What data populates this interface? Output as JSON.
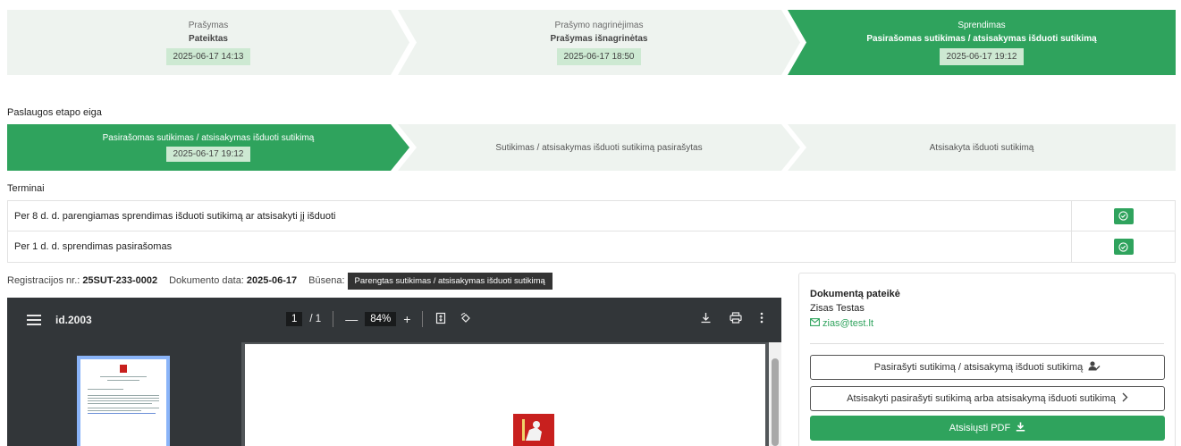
{
  "stepper": {
    "steps": [
      {
        "title": "Prašymas",
        "subtitle": "Pateiktas",
        "date": "2025-06-17 14:13"
      },
      {
        "title": "Prašymo nagrinėjimas",
        "subtitle": "Prašymas išnagrinėtas",
        "date": "2025-06-17 18:50"
      },
      {
        "title": "Sprendimas",
        "subtitle": "Pasirašomas sutikimas / atsisakymas išduoti sutikimą",
        "date": "2025-06-17 19:12"
      }
    ],
    "active_color": "#2fa35d"
  },
  "stage_flow": {
    "heading": "Paslaugos etapo eiga",
    "steps": [
      {
        "label": "Pasirašomas sutikimas / atsisakymas išduoti sutikimą",
        "date": "2025-06-17 19:12"
      },
      {
        "label": "Sutikimas / atsisakymas išduoti sutikimą pasirašytas"
      },
      {
        "label": "Atsisakyta išduoti sutikimą"
      }
    ]
  },
  "terms": {
    "heading": "Terminai",
    "rows": [
      {
        "text": "Per 8 d. d. parengiamas sprendimas išduoti sutikimą ar atsisakyti jį išduoti",
        "status_icon": "check-circle-icon"
      },
      {
        "text": "Per 1 d. d. sprendimas pasirašomas",
        "status_icon": "check-circle-icon"
      }
    ]
  },
  "document_meta": {
    "reg_label": "Registracijos nr.:",
    "reg_value": "25SUT-233-0002",
    "date_label": "Dokumento data:",
    "date_value": "2025-06-17",
    "status_label": "Būsena:",
    "status_value": "Parengtas sutikimas / atsisakymas išduoti sutikimą"
  },
  "pdf_viewer": {
    "file_name": "id.2003",
    "page_current": "1",
    "page_total": "/ 1",
    "zoom": "84%",
    "minus": "—",
    "plus": "+"
  },
  "submitter": {
    "title": "Dokumentą pateikė",
    "name": "Zisas Testas",
    "email": "zias@test.lt"
  },
  "actions": {
    "sign_label": "Pasirašyti sutikimą / atsisakymą išduoti sutikimą",
    "refuse_label": "Atsisakyti pasirašyti sutikimą arba atsisakymą išduoti sutikimą",
    "download_label": "Atsisiųsti PDF"
  }
}
